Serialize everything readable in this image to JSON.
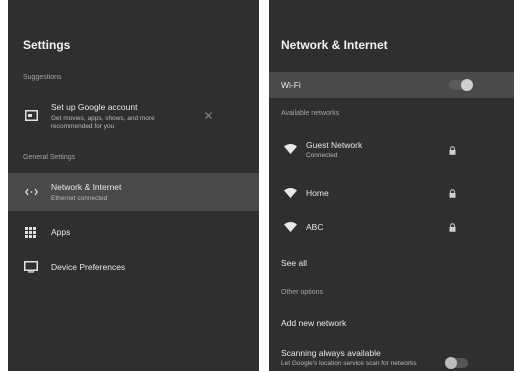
{
  "settings": {
    "title": "Settings",
    "suggestions_header": "Suggestions",
    "suggestion": {
      "title": "Set up Google account",
      "subtitle_line1": "Get movies, apps, shows, and more",
      "subtitle_line2": "recommended for you"
    },
    "general_header": "General Settings",
    "items": [
      {
        "label": "Network & Internet",
        "sublabel": "Ethernet connected",
        "icon": "network-icon"
      },
      {
        "label": "Apps",
        "sublabel": "",
        "icon": "apps-grid-icon"
      },
      {
        "label": "Device Preferences",
        "sublabel": "",
        "icon": "display-icon"
      }
    ]
  },
  "network": {
    "title": "Network & Internet",
    "wifi_label": "Wi-Fi",
    "wifi_on": true,
    "available_header": "Available networks",
    "networks": [
      {
        "name": "Guest Network",
        "status": "Connected",
        "icon": "wifi-icon",
        "lock": "lock-icon"
      },
      {
        "name": "Home",
        "status": "",
        "icon": "wifi-icon",
        "lock": "lock-icon"
      },
      {
        "name": "ABC",
        "status": "",
        "icon": "wifi-icon",
        "lock": "lock-icon"
      }
    ],
    "see_all": "See all",
    "other_options_header": "Other options",
    "add_network": "Add new network",
    "scanning_title": "Scanning always available",
    "scanning_sub": "Let Google's location service scan for networks",
    "scanning_on": false
  },
  "colors": {
    "panel_bg": "#2f2f2f",
    "selected_bg": "#4a4a4a"
  }
}
